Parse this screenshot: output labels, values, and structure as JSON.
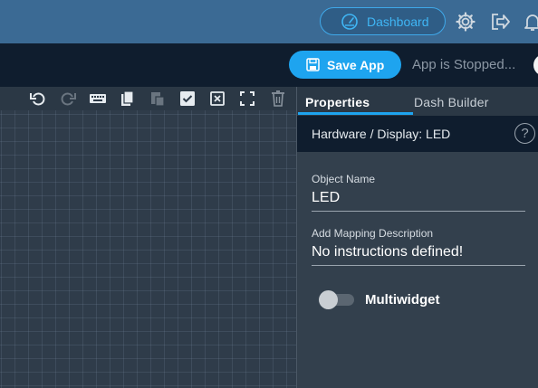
{
  "topbar": {
    "dashboard_label": "Dashboard",
    "icons": [
      "dashboard-icon",
      "gear-icon",
      "logout-icon",
      "bell-icon"
    ]
  },
  "appbar": {
    "save_label": "Save App",
    "status_text": "App is Stopped..."
  },
  "toolbar": {
    "icons": [
      "undo-icon",
      "redo-icon",
      "keyboard-icon",
      "copy-icon",
      "paste-icon",
      "check-icon",
      "close-box-icon",
      "fullscreen-icon",
      "trash-icon"
    ]
  },
  "panel": {
    "tabs": [
      {
        "label": "Properties",
        "active": true
      },
      {
        "label": "Dash Builder",
        "active": false
      }
    ],
    "header": "Hardware / Display: LED",
    "help_symbol": "?",
    "fields": [
      {
        "label": "Object Name",
        "value": "LED"
      },
      {
        "label": "Add Mapping Description",
        "value": "No instructions defined!"
      }
    ],
    "multiwidget": {
      "label": "Multiwidget",
      "enabled": false
    }
  },
  "colors": {
    "accent": "#1ea4ef",
    "topbar": "#3b6a94",
    "darkbar": "#0f1d2e",
    "panel": "#33404d"
  }
}
